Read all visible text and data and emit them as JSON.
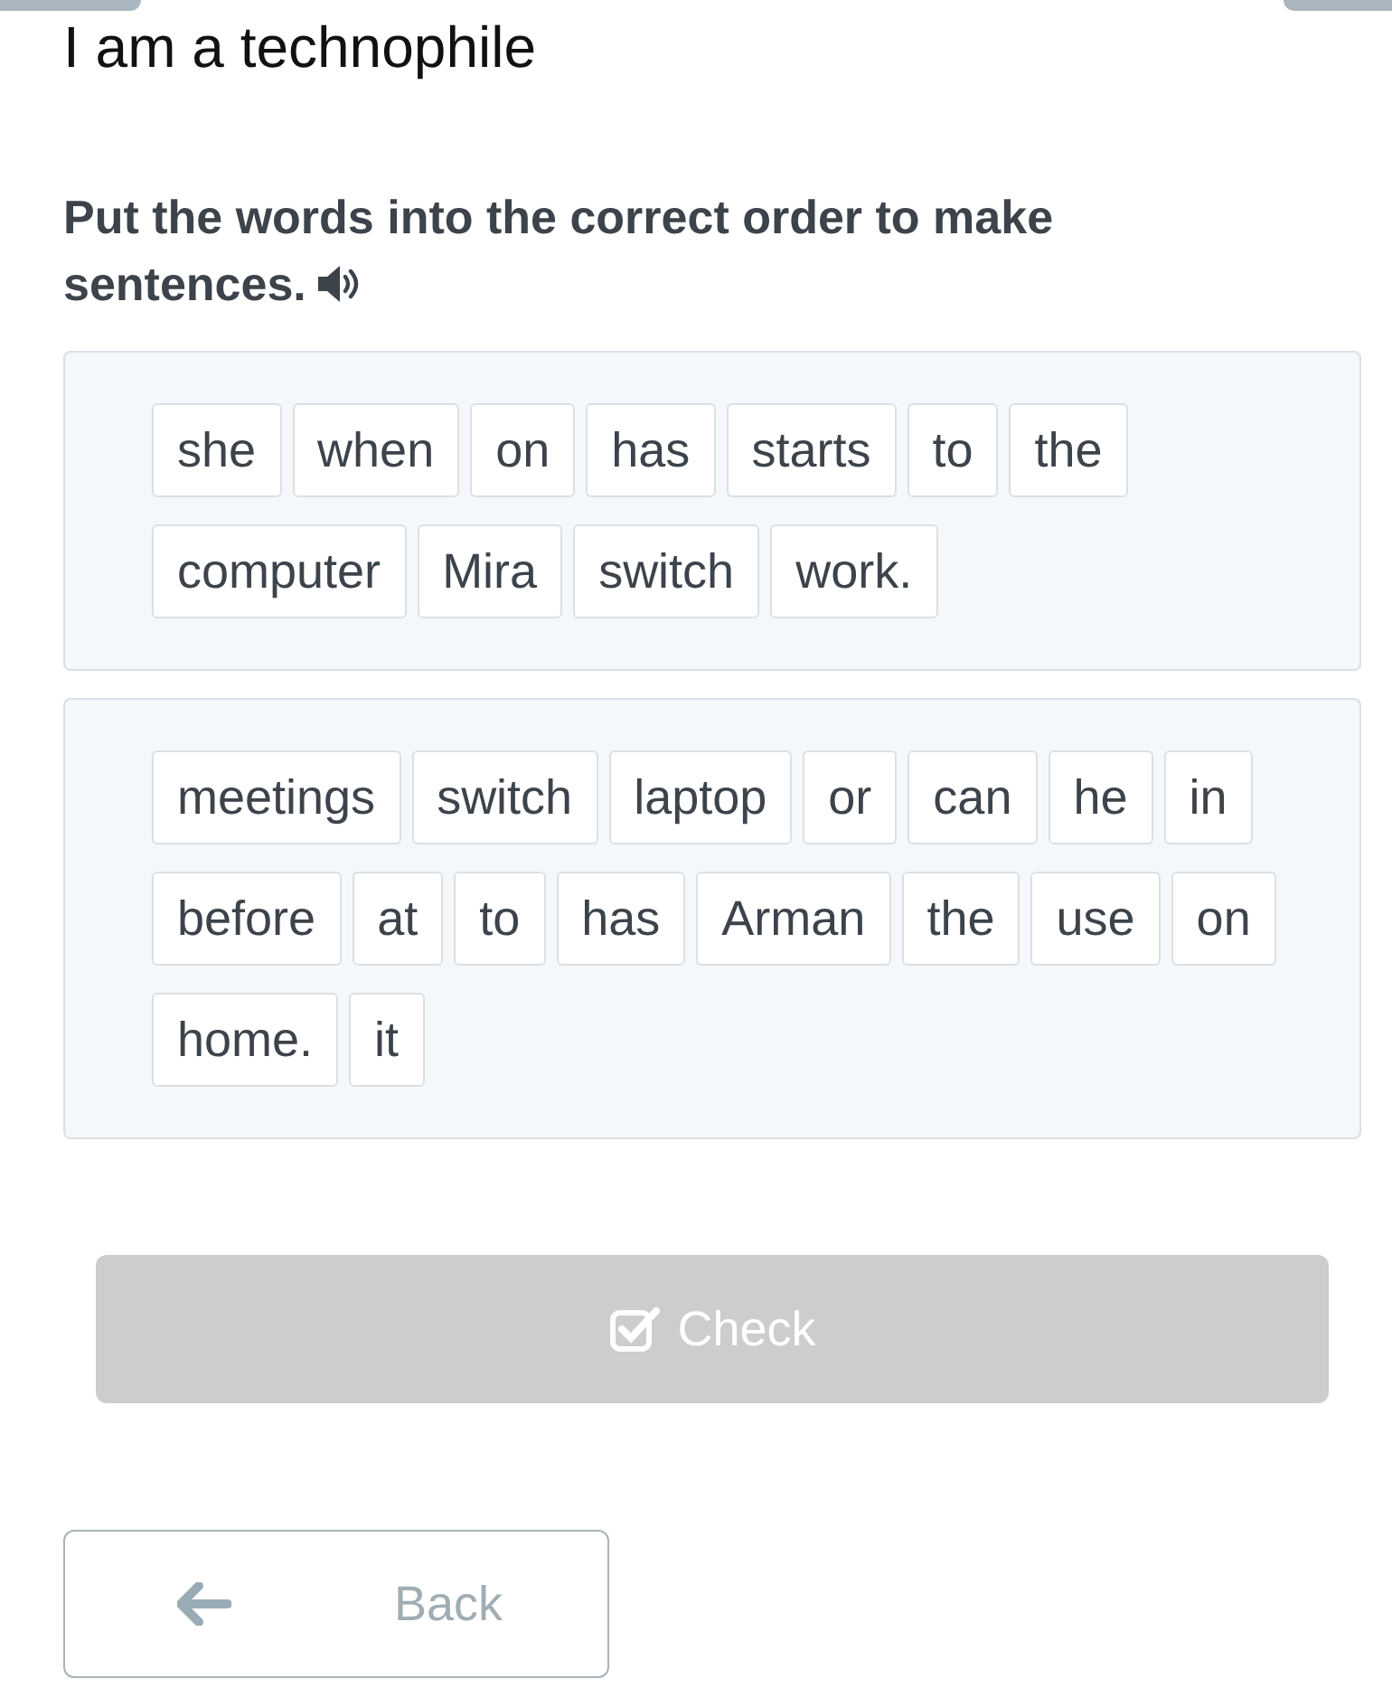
{
  "title": "I am a technophile",
  "instruction": "Put the words into the correct order to make sentences.",
  "exercises": [
    {
      "words": [
        "she",
        "when",
        "on",
        "has",
        "starts",
        "to",
        "the",
        "computer",
        "Mira",
        "switch",
        "work."
      ]
    },
    {
      "words": [
        "meetings",
        "switch",
        "laptop",
        "or",
        "can",
        "he",
        "in",
        "before",
        "at",
        "to",
        "has",
        "Arman",
        "the",
        "use",
        "on",
        "home.",
        "it"
      ]
    }
  ],
  "check_button": {
    "label": "Check",
    "disabled": true
  },
  "back_button": {
    "label": "Back"
  }
}
